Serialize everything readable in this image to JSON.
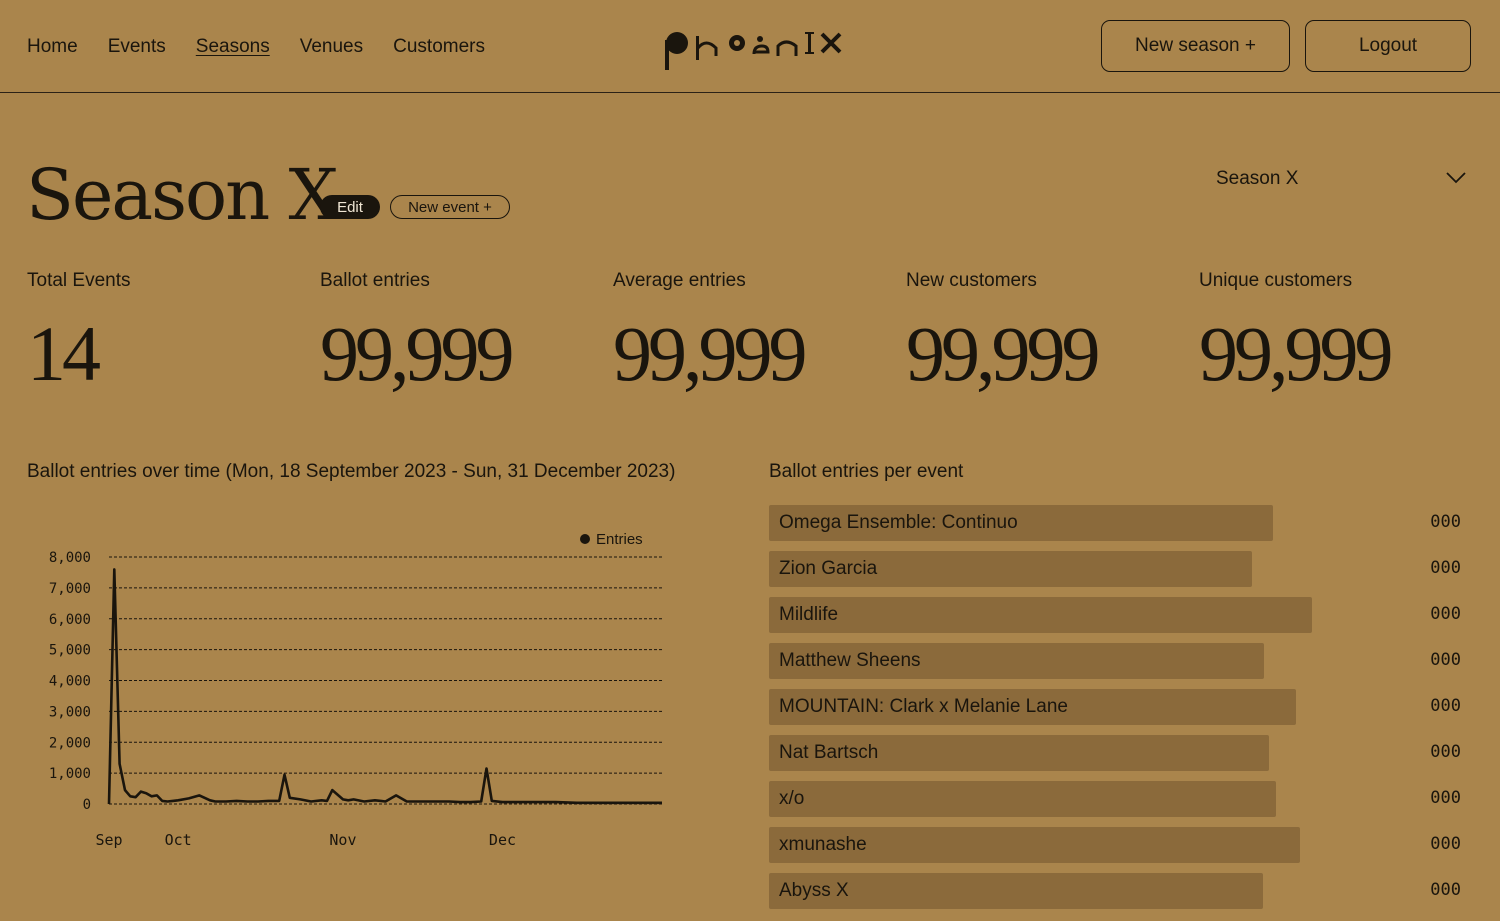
{
  "nav": {
    "links": [
      "Home",
      "Events",
      "Seasons",
      "Venues",
      "Customers"
    ],
    "active_index": 2,
    "logo_text": "phoenix",
    "new_season_label": "New season +",
    "logout_label": "Logout"
  },
  "header": {
    "title": "Season X",
    "edit_label": "Edit",
    "new_event_label": "New event +",
    "season_select_value": "Season X"
  },
  "stats": [
    {
      "label": "Total Events",
      "value": "14"
    },
    {
      "label": "Ballot entries",
      "value": "99,999"
    },
    {
      "label": "Average entries",
      "value": "99,999"
    },
    {
      "label": "New customers",
      "value": "99,999"
    },
    {
      "label": "Unique customers",
      "value": "99,999"
    }
  ],
  "line_section_title": "Ballot entries over time (Mon, 18 September 2023 - Sun, 31 December 2023)",
  "bar_section_title": "Ballot entries per event",
  "colors": {
    "background": "#AA854C",
    "bar": "#8B6A3B",
    "ink": "#1a150d"
  },
  "chart_data": [
    {
      "type": "line",
      "title": "Ballot entries over time (Mon, 18 September 2023 - Sun, 31 December 2023)",
      "xlabel": "",
      "ylabel": "",
      "ylim": [
        0,
        8000
      ],
      "yticks": [
        0,
        1000,
        2000,
        3000,
        4000,
        5000,
        6000,
        7000,
        8000
      ],
      "ytick_labels": [
        "0",
        "1,000",
        "2,000",
        "3,000",
        "4,000",
        "5,000",
        "6,000",
        "7,000",
        "8,000"
      ],
      "xtick_labels": [
        "Sep",
        "Oct",
        "Nov",
        "Dec"
      ],
      "xtick_days": [
        0,
        13,
        44,
        74
      ],
      "xlim": [
        0,
        104
      ],
      "grid": true,
      "legend_position": "top-right",
      "series": [
        {
          "name": "Entries",
          "x": [
            0,
            1,
            2,
            3,
            4,
            5,
            6,
            7,
            8,
            9,
            10,
            11,
            12,
            13,
            15,
            17,
            19,
            20,
            22,
            24,
            26,
            28,
            30,
            32,
            33,
            34,
            36,
            38,
            40,
            41,
            42,
            44,
            45,
            46,
            48,
            50,
            52,
            54,
            56,
            58,
            60,
            62,
            64,
            66,
            68,
            70,
            71,
            72,
            74,
            76,
            78,
            80,
            84,
            88,
            92,
            96,
            100,
            104
          ],
          "y": [
            0,
            7600,
            1300,
            450,
            250,
            220,
            400,
            350,
            250,
            280,
            100,
            80,
            100,
            120,
            180,
            280,
            120,
            80,
            80,
            100,
            80,
            80,
            100,
            100,
            950,
            200,
            150,
            80,
            120,
            100,
            450,
            150,
            120,
            150,
            80,
            120,
            80,
            280,
            80,
            80,
            80,
            80,
            80,
            60,
            60,
            80,
            1150,
            100,
            60,
            60,
            60,
            60,
            60,
            40,
            40,
            40,
            40,
            40
          ]
        }
      ]
    },
    {
      "type": "bar",
      "title": "Ballot entries per event",
      "orientation": "horizontal",
      "categories": [
        "Omega Ensemble: Continuo",
        "Zion Garcia",
        "Mildlife",
        "Matthew Sheens",
        "MOUNTAIN: Clark x Melanie Lane",
        "Nat Bartsch",
        "x/o",
        "xmunashe",
        "Abyss X"
      ],
      "values": [
        0.72,
        0.69,
        0.775,
        0.707,
        0.753,
        0.714,
        0.724,
        0.758,
        0.706
      ],
      "value_labels": [
        "000",
        "000",
        "000",
        "000",
        "000",
        "000",
        "000",
        "000",
        "000"
      ]
    }
  ]
}
